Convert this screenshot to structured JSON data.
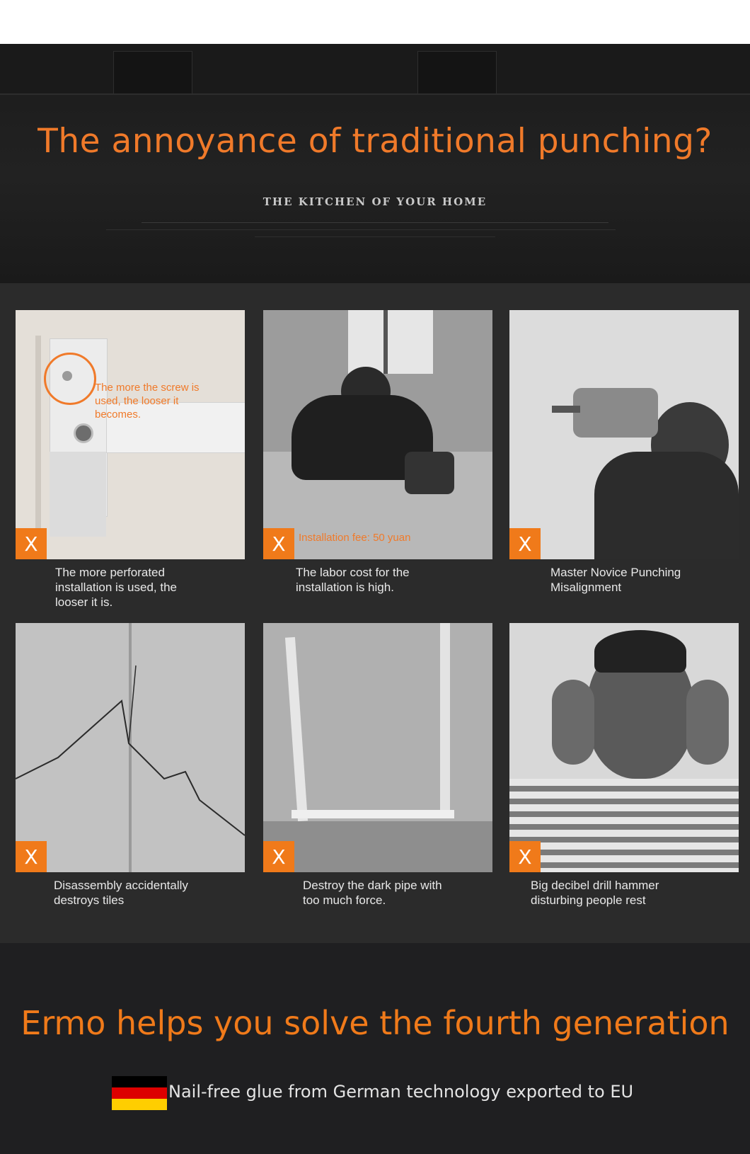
{
  "hero": {
    "title": "The annoyance of traditional punching?",
    "subtitle": "THE KITCHEN OF YOUR HOME"
  },
  "cards": [
    {
      "badge": "X",
      "overlay": "The more the screw is used, the looser it becomes.",
      "caption": "The more perforated installation is used, the looser it is."
    },
    {
      "badge": "X",
      "overlay": "Installation fee: 50 yuan",
      "caption": "The labor cost for the installation is high."
    },
    {
      "badge": "X",
      "overlay": "",
      "caption": "Master Novice Punching Misalignment"
    },
    {
      "badge": "X",
      "overlay": "",
      "caption": "Disassembly accidentally destroys tiles"
    },
    {
      "badge": "X",
      "overlay": "",
      "caption": "Destroy the dark pipe with too much force."
    },
    {
      "badge": "X",
      "overlay": "",
      "caption": "Big decibel drill hammer disturbing people rest"
    }
  ],
  "footer": {
    "title": "Ermo helps you solve the fourth generation",
    "tagline": "Nail-free glue from German technology exported to EU",
    "flag_colors": [
      "#000000",
      "#dd0000",
      "#ffce00"
    ]
  },
  "colors": {
    "accent": "#f07a1a",
    "dark": "#2b2b2b"
  }
}
